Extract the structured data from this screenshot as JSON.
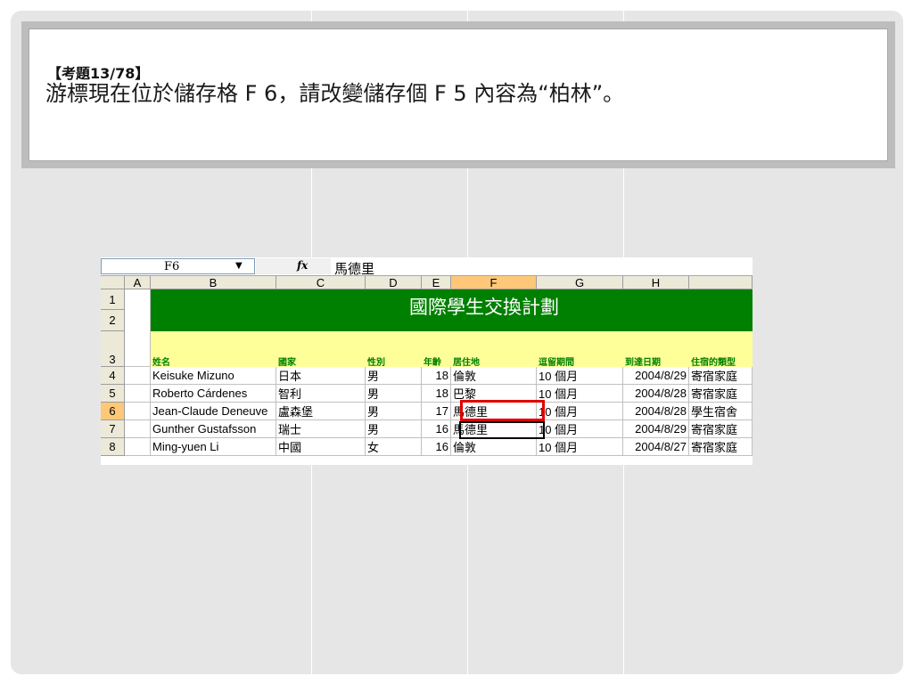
{
  "question": {
    "header": "【考題13/78】",
    "text": "游標現在位於儲存格 F 6，請改變儲存個 F 5 內容為“柏林”。"
  },
  "sheet": {
    "namebox": "F6",
    "fx": "fx",
    "formula_value": "馬德里",
    "columns": [
      "A",
      "B",
      "C",
      "D",
      "E",
      "F",
      "G",
      "H"
    ],
    "active_column": "F",
    "title": "國際學生交換計劃",
    "headers": [
      "姓名",
      "國家",
      "性別",
      "年齡",
      "居住地",
      "逗留期間",
      "到達日期",
      "住宿的類型"
    ],
    "row_numbers": [
      "1",
      "2",
      "3",
      "4",
      "5",
      "6",
      "7",
      "8"
    ],
    "active_row": "6",
    "rows": [
      [
        "Keisuke Mizuno",
        "日本",
        "男",
        "18",
        "倫敦",
        "10 個月",
        "2004/8/29",
        "寄宿家庭"
      ],
      [
        "Roberto Cárdenes",
        "智利",
        "男",
        "18",
        "巴黎",
        "10 個月",
        "2004/8/28",
        "寄宿家庭"
      ],
      [
        "Jean-Claude Deneuve",
        "盧森堡",
        "男",
        "17",
        "馬德里",
        "10 個月",
        "2004/8/28",
        "學生宿舍"
      ],
      [
        "Gunther Gustafsson",
        "瑞士",
        "男",
        "16",
        "馬德里",
        "10 個月",
        "2004/8/29",
        "寄宿家庭"
      ],
      [
        "Ming-yuen Li",
        "中國",
        "女",
        "16",
        "倫敦",
        "10 個月",
        "2004/8/27",
        "寄宿家庭"
      ]
    ]
  },
  "colors": {
    "title_band": "#008000",
    "header_band": "#ffff99",
    "selection_red": "#e00000"
  }
}
